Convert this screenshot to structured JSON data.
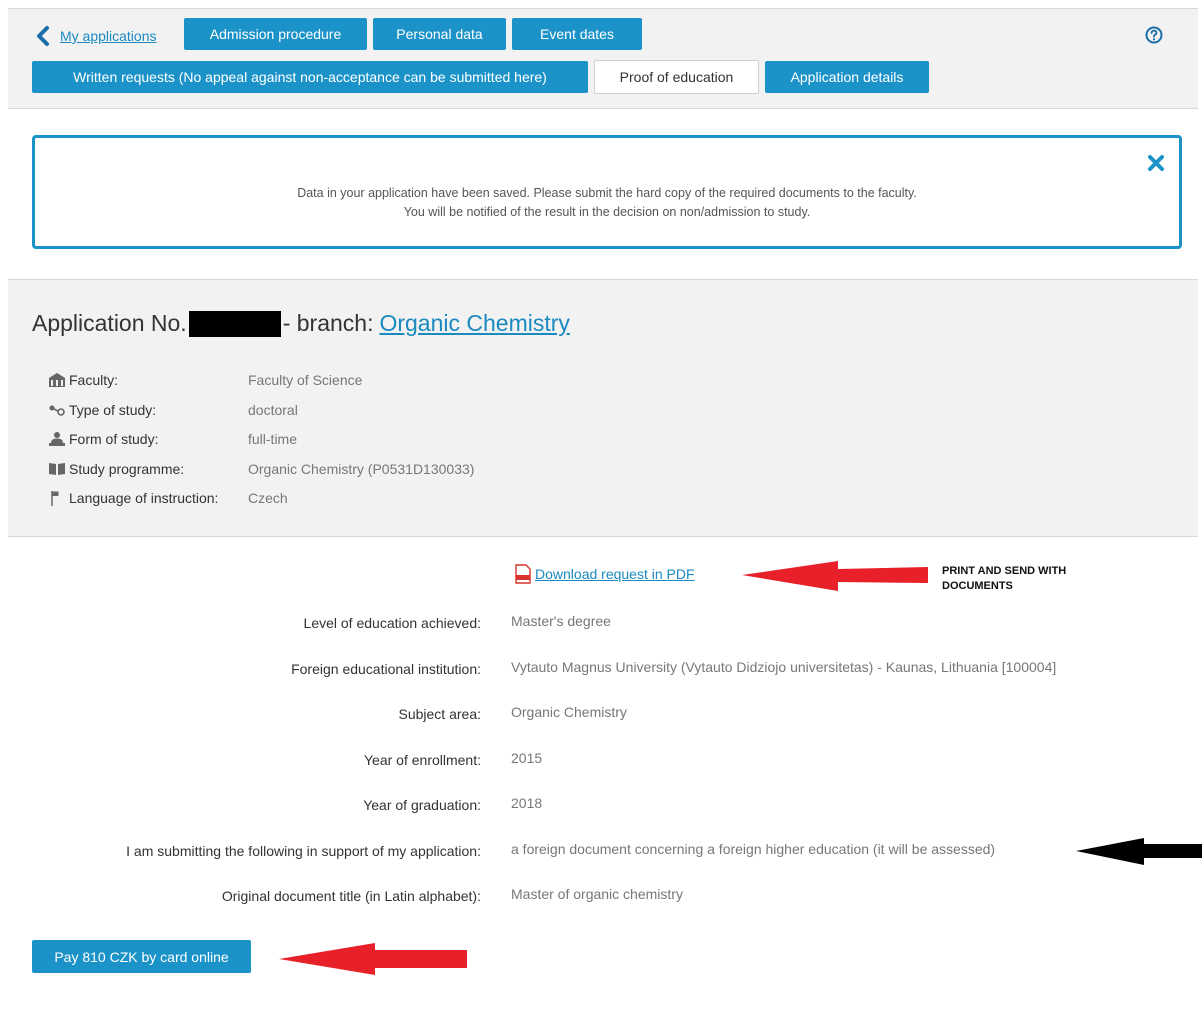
{
  "nav": {
    "back_label": "My applications",
    "tabs": [
      {
        "label": "Admission procedure",
        "active": true
      },
      {
        "label": "Personal data",
        "active": true
      },
      {
        "label": "Event dates",
        "active": true
      },
      {
        "label": "Written requests (No appeal against non-acceptance can be submitted here)",
        "active": true
      },
      {
        "label": "Proof of education",
        "active": false
      },
      {
        "label": "Application details",
        "active": true
      }
    ],
    "help_icon": "question-circle-icon"
  },
  "notice": {
    "line1": "Data in your application have been saved. Please submit the hard copy of the required documents to the faculty.",
    "line2": "You will be notified of the result in the decision on non/admission to study.",
    "close_icon": "close-icon"
  },
  "application": {
    "title_prefix": "Application No.",
    "title_mid": "- branch:",
    "branch": "Organic Chemistry",
    "info": [
      {
        "icon": "building-icon",
        "label": "Faculty:",
        "value": "Faculty of Science"
      },
      {
        "icon": "study-type-icon",
        "label": "Type of study:",
        "value": "doctoral"
      },
      {
        "icon": "person-desk-icon",
        "label": "Form of study:",
        "value": "full-time"
      },
      {
        "icon": "book-icon",
        "label": "Study programme:",
        "value": "Organic Chemistry (P0531D130033)"
      },
      {
        "icon": "flag-icon",
        "label": "Language of instruction:",
        "value": "Czech"
      }
    ]
  },
  "download": {
    "label": "Download request in PDF",
    "icon": "pdf-icon"
  },
  "annotation": {
    "line1": "PRINT AND SEND WITH",
    "line2": "DOCUMENTS"
  },
  "details": [
    {
      "label": "Level of education achieved:",
      "value": "Master's degree"
    },
    {
      "label": "Foreign educational institution:",
      "value": "Vytauto Magnus University (Vytauto Didziojo universitetas) - Kaunas, Lithuania [100004]"
    },
    {
      "label": "Subject area:",
      "value": "Organic Chemistry"
    },
    {
      "label": "Year of enrollment:",
      "value": "2015"
    },
    {
      "label": "Year of graduation:",
      "value": "2018"
    },
    {
      "label": "I am submitting the following in support of my application:",
      "value": "a foreign document concerning a foreign higher education (it will be assessed)"
    },
    {
      "label": "Original document title (in Latin alphabet):",
      "value": "Master of organic chemistry"
    }
  ],
  "pay_button": "Pay 810 CZK by card online",
  "colors": {
    "accent": "#1b93c8",
    "arrow_red": "#e8202a",
    "arrow_black": "#000000"
  }
}
